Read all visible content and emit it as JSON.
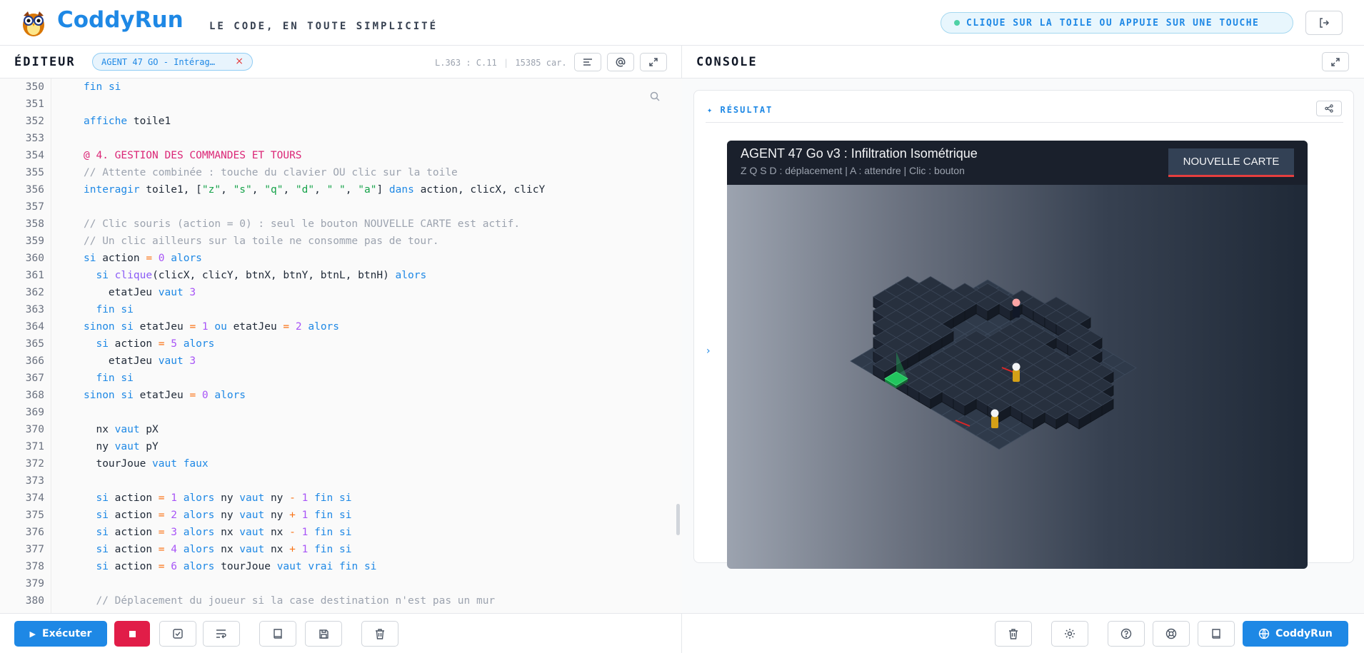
{
  "header": {
    "brand": "CoddyRun",
    "tagline": "LE CODE, EN TOUTE SIMPLICITÉ",
    "hint": "CLIQUE SUR LA TOILE OU APPUIE SUR UNE TOUCHE",
    "hint_dot_color": "#4fd1a5",
    "logout_icon": "logout-icon"
  },
  "editor": {
    "title": "ÉDITEUR",
    "file_tab": "AGENT 47 GO - Intérag…",
    "file_close": "×",
    "cursor_pos": "L.363 : C.11",
    "separator": "|",
    "char_count": "15385 car.",
    "lines": [
      {
        "n": "350",
        "t": "fin si"
      },
      {
        "n": "351",
        "t": ""
      },
      {
        "n": "352",
        "t": "affiche toile1"
      },
      {
        "n": "353",
        "t": ""
      },
      {
        "n": "354",
        "t": "@ 4. GESTION DES COMMANDES ET TOURS"
      },
      {
        "n": "355",
        "t": "// Attente combinée : touche du clavier OU clic sur la toile"
      },
      {
        "n": "356",
        "t": "interagir toile1, [\"z\", \"s\", \"q\", \"d\", \" \", \"a\"] dans action, clicX, clicY"
      },
      {
        "n": "357",
        "t": ""
      },
      {
        "n": "358",
        "t": "// Clic souris (action = 0) : seul le bouton NOUVELLE CARTE est actif."
      },
      {
        "n": "359",
        "t": "// Un clic ailleurs sur la toile ne consomme pas de tour."
      },
      {
        "n": "360",
        "t": "si action = 0 alors"
      },
      {
        "n": "361",
        "t": "  si clique(clicX, clicY, btnX, btnY, btnL, btnH) alors"
      },
      {
        "n": "362",
        "t": "    etatJeu vaut 3"
      },
      {
        "n": "363",
        "t": "  fin si"
      },
      {
        "n": "364",
        "t": "sinon si etatJeu = 1 ou etatJeu = 2 alors"
      },
      {
        "n": "365",
        "t": "  si action = 5 alors"
      },
      {
        "n": "366",
        "t": "    etatJeu vaut 3"
      },
      {
        "n": "367",
        "t": "  fin si"
      },
      {
        "n": "368",
        "t": "sinon si etatJeu = 0 alors"
      },
      {
        "n": "369",
        "t": ""
      },
      {
        "n": "370",
        "t": "  nx vaut pX"
      },
      {
        "n": "371",
        "t": "  ny vaut pY"
      },
      {
        "n": "372",
        "t": "  tourJoue vaut faux"
      },
      {
        "n": "373",
        "t": ""
      },
      {
        "n": "374",
        "t": "  si action = 1 alors ny vaut ny - 1 fin si"
      },
      {
        "n": "375",
        "t": "  si action = 2 alors ny vaut ny + 1 fin si"
      },
      {
        "n": "376",
        "t": "  si action = 3 alors nx vaut nx - 1 fin si"
      },
      {
        "n": "377",
        "t": "  si action = 4 alors nx vaut nx + 1 fin si"
      },
      {
        "n": "378",
        "t": "  si action = 6 alors tourJoue vaut vrai fin si"
      },
      {
        "n": "379",
        "t": ""
      },
      {
        "n": "380",
        "t": "  // Déplacement du joueur si la case destination n'est pas un mur"
      }
    ]
  },
  "console": {
    "title": "CONSOLE",
    "result_label": "RÉSULTAT",
    "result_star": "✦",
    "chevron": "›",
    "game": {
      "title": "AGENT 47 Go v3 : Infiltration Isométrique",
      "controls": "Z Q S D : déplacement | A : attendre | Clic : bouton",
      "new_map_button": "NOUVELLE CARTE"
    }
  },
  "footer": {
    "run_label": "Exécuter",
    "run_icon": "play-icon",
    "stop_icon": "stop-icon",
    "brand_button": "CoddyRun"
  },
  "colors": {
    "accent": "#1e88e5",
    "stop": "#e11d48",
    "goal": "#22c55e"
  }
}
